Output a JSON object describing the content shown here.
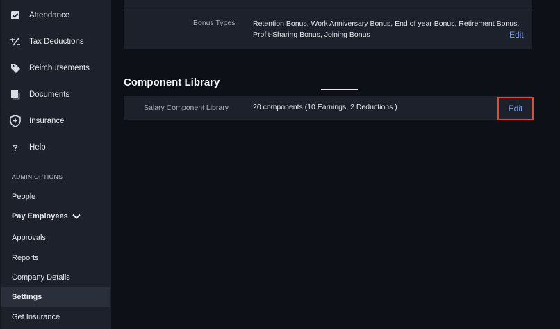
{
  "sidebar": {
    "items": [
      {
        "label": "Attendance",
        "icon": "attendance-checkbox-icon"
      },
      {
        "label": "Tax Deductions",
        "icon": "percent-icon"
      },
      {
        "label": "Reimbursements",
        "icon": "tag-icon"
      },
      {
        "label": "Documents",
        "icon": "documents-icon"
      },
      {
        "label": "Insurance",
        "icon": "shield-plus-icon"
      },
      {
        "label": "Help",
        "icon": "question-icon"
      }
    ],
    "admin_section_label": "ADMIN OPTIONS",
    "admin_items": [
      {
        "label": "People"
      },
      {
        "label": "Pay Employees"
      },
      {
        "label": "Approvals"
      },
      {
        "label": "Reports"
      },
      {
        "label": "Company Details"
      },
      {
        "label": "Settings"
      },
      {
        "label": "Get Insurance"
      }
    ]
  },
  "bonus": {
    "label": "Bonus Types",
    "value": "Retention Bonus, Work Anniversary Bonus, End of year Bonus, Retirement Bonus, Profit-Sharing Bonus, Joining Bonus",
    "edit_label": "Edit"
  },
  "component_library": {
    "title": "Component Library",
    "row_label": "Salary Component Library",
    "row_value": "20 components  (10 Earnings, 2 Deductions )",
    "edit_label": "Edit"
  },
  "colors": {
    "background": "#0d1117",
    "panel": "#1c212b",
    "link": "#6f9ff5",
    "highlight": "#e8492e"
  }
}
